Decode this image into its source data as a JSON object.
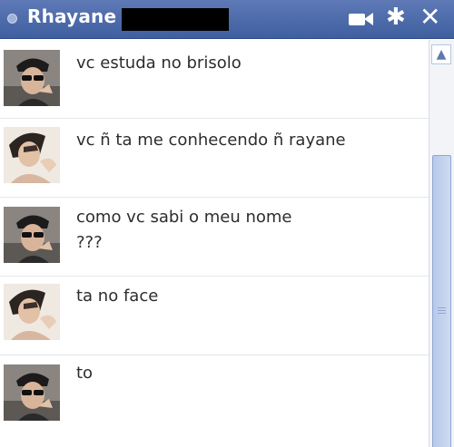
{
  "header": {
    "contact_name": "Rhayane",
    "icons": [
      "status-dot-icon",
      "video-camera-icon",
      "gear-icon",
      "close-icon"
    ]
  },
  "messages": [
    {
      "text": "vc estuda no brisolo",
      "avatar": "sender-avatar"
    },
    {
      "text": "vc ñ ta me conhecendo ñ rayane",
      "avatar": "contact-avatar"
    },
    {
      "text": "como vc sabi o meu nome\n???",
      "avatar": "sender-avatar"
    },
    {
      "text": "ta no face",
      "avatar": "contact-avatar"
    },
    {
      "text": "to",
      "avatar": "sender-avatar"
    }
  ],
  "colors": {
    "titlebar": "#4a67a8",
    "text": "#2d2d2d",
    "separator": "#e4e6eb",
    "scroll_thumb": "#c3d2ee"
  }
}
